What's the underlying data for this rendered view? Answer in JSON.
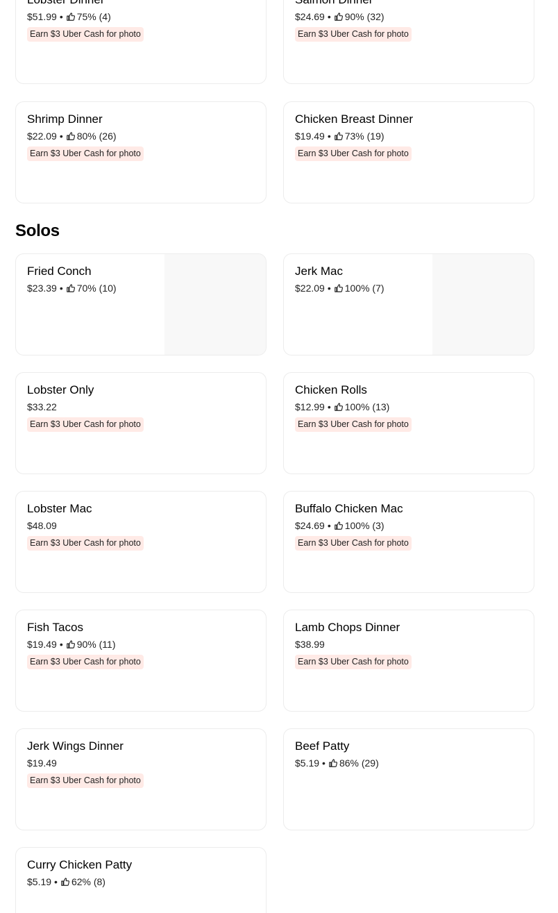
{
  "items_top": [
    {
      "name": "Lobster Dinner",
      "price": "$51.99",
      "rating": "75% (4)",
      "promo": "Earn $3 Uber Cash for photo"
    },
    {
      "name": "Salmon Dinner",
      "price": "$24.69",
      "rating": "90% (32)",
      "promo": "Earn $3 Uber Cash for photo"
    },
    {
      "name": "Shrimp Dinner",
      "price": "$22.09",
      "rating": "80% (26)",
      "promo": "Earn $3 Uber Cash for photo"
    },
    {
      "name": "Chicken Breast Dinner",
      "price": "$19.49",
      "rating": "73% (19)",
      "promo": "Earn $3 Uber Cash for photo"
    }
  ],
  "solos": {
    "title": "Solos",
    "items": [
      {
        "name": "Fried Conch",
        "price": "$23.39",
        "rating": "70% (10)"
      },
      {
        "name": "Jerk Mac",
        "price": "$22.09",
        "rating": "100% (7)"
      },
      {
        "name": "Lobster Only",
        "price": "$33.22",
        "promo": "Earn $3 Uber Cash for photo"
      },
      {
        "name": "Chicken Rolls",
        "price": "$12.99",
        "rating": "100% (13)",
        "promo": "Earn $3 Uber Cash for photo"
      },
      {
        "name": "Lobster Mac",
        "price": "$48.09",
        "promo": "Earn $3 Uber Cash for photo"
      },
      {
        "name": "Buffalo Chicken Mac",
        "price": "$24.69",
        "rating": "100% (3)",
        "promo": "Earn $3 Uber Cash for photo"
      },
      {
        "name": "Fish Tacos",
        "price": "$19.49",
        "rating": "90% (11)",
        "promo": "Earn $3 Uber Cash for photo"
      },
      {
        "name": "Lamb Chops Dinner",
        "price": "$38.99",
        "promo": "Earn $3 Uber Cash for photo"
      },
      {
        "name": "Jerk Wings Dinner",
        "price": "$19.49",
        "promo": "Earn $3 Uber Cash for photo"
      },
      {
        "name": "Beef Patty",
        "price": "$5.19",
        "rating": "86% (29)"
      },
      {
        "name": "Curry Chicken Patty",
        "price": "$5.19",
        "rating": "62% (8)"
      }
    ]
  },
  "icons": {
    "rating": "thumbs-up-icon",
    "separator": "•"
  },
  "colors": {
    "promo_bg": "#ffeae6",
    "card_border": "#ececec",
    "image_placeholder": "#f8f8f8"
  }
}
